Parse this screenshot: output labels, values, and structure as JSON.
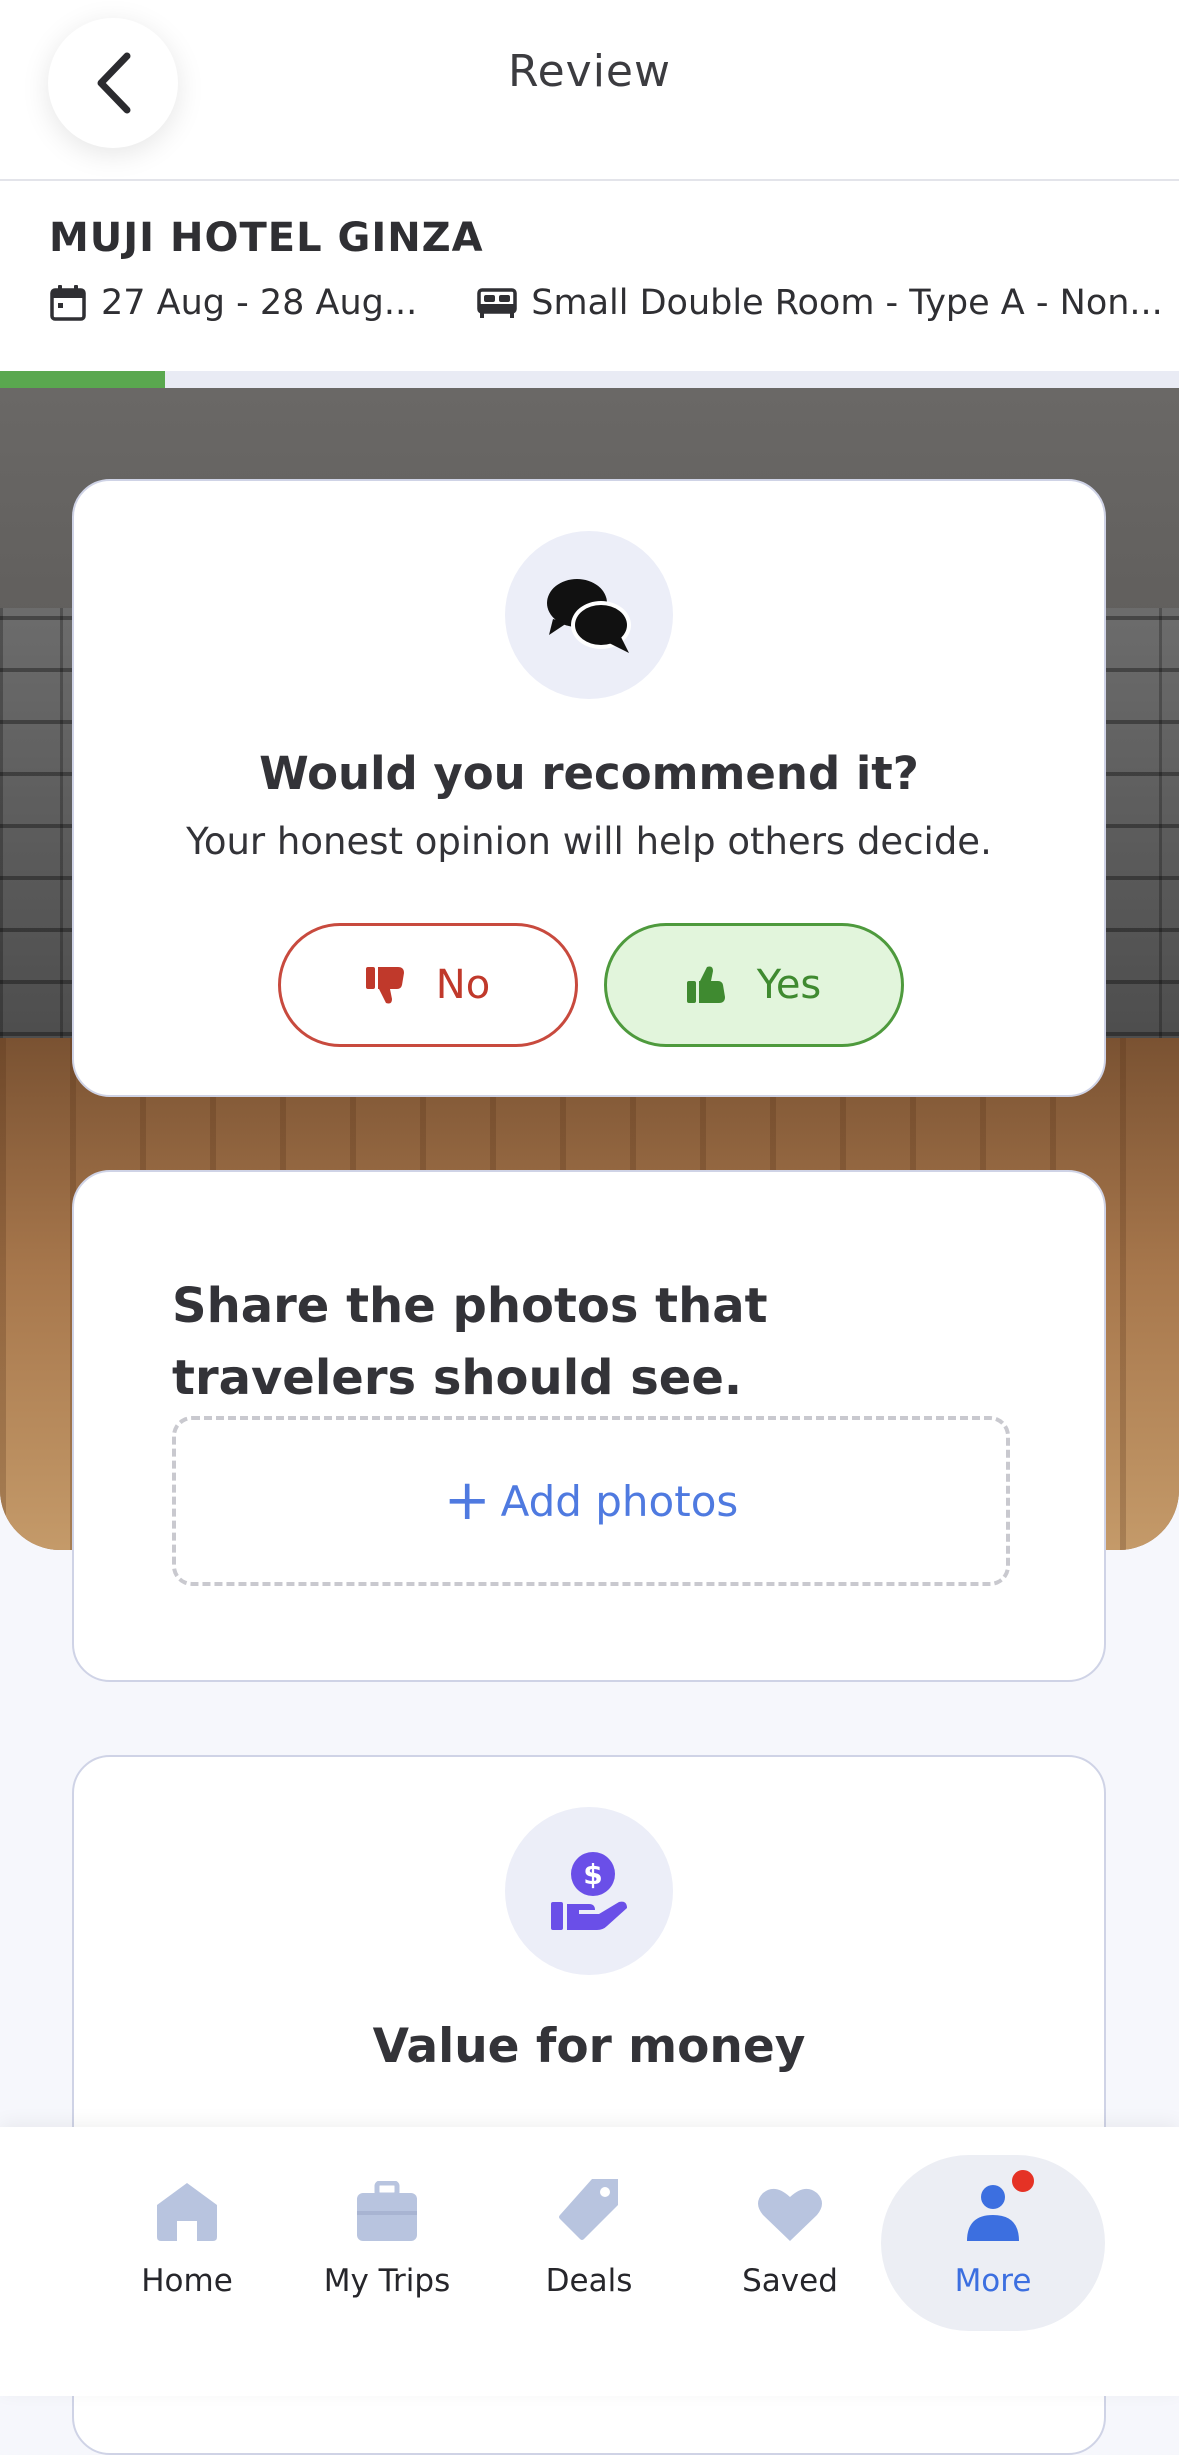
{
  "header": {
    "title": "Review",
    "back_icon": "chevron-left-icon"
  },
  "hotel": {
    "name": "MUJI HOTEL GINZA",
    "dates": "27 Aug - 28 Aug...",
    "room": "Small Double Room - Type A - Non..."
  },
  "progress": {
    "fraction": 0.14,
    "color": "#5aa84f"
  },
  "recommend": {
    "icon": "chat-bubbles-icon",
    "title": "Would you recommend it?",
    "subtitle": "Your honest opinion will help others decide.",
    "no_label": "No",
    "yes_label": "Yes",
    "selected": "Yes"
  },
  "photos": {
    "title": "Share the photos that travelers should see.",
    "add_label": "Add photos"
  },
  "value": {
    "icon": "hand-money-icon",
    "title": "Value for money"
  },
  "nav": {
    "items": [
      {
        "label": "Home",
        "icon": "home-icon"
      },
      {
        "label": "My Trips",
        "icon": "suitcase-icon"
      },
      {
        "label": "Deals",
        "icon": "tag-icon"
      },
      {
        "label": "Saved",
        "icon": "heart-icon"
      },
      {
        "label": "More",
        "icon": "person-icon"
      }
    ],
    "active": "More"
  },
  "colors": {
    "accent": "#3c6fe0",
    "no": "#c0392b",
    "yes": "#3f8a30",
    "money_icon": "#6a4fe8"
  }
}
